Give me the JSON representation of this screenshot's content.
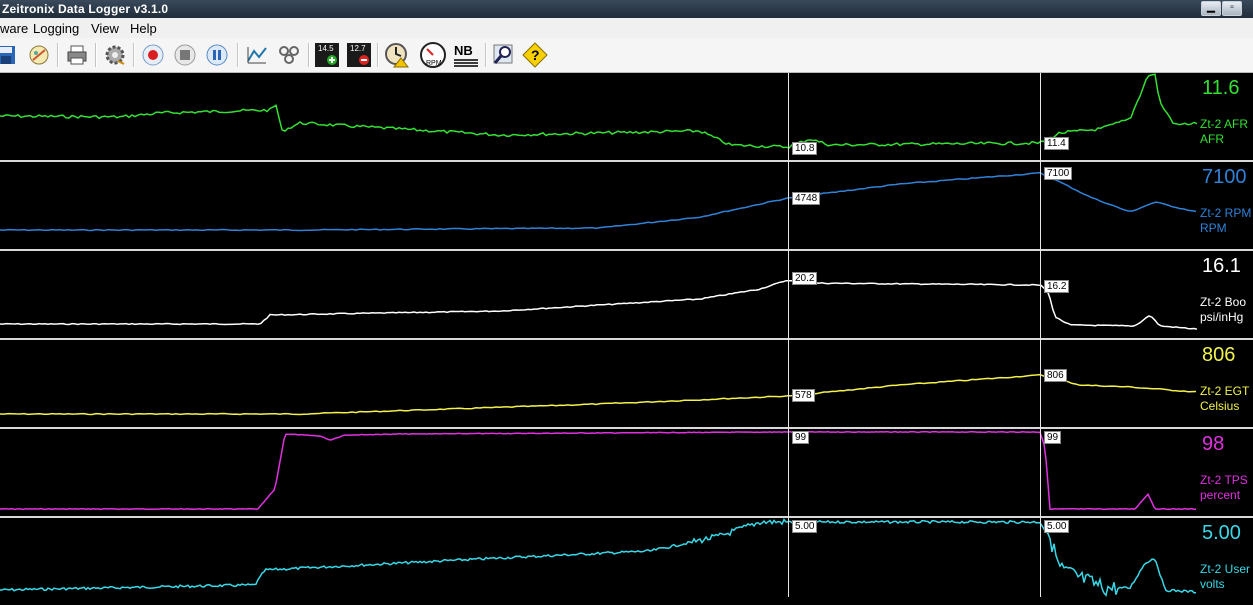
{
  "window": {
    "title": "Zeitronix Data Logger v3.1.0"
  },
  "menu": [
    "ware",
    "Logging",
    "View",
    "Help"
  ],
  "toolbar": {
    "icons": [
      "save-icon",
      "open-log-icon",
      "print-icon",
      "settings-gear-icon",
      "record-icon",
      "stop-icon",
      "pause-icon",
      "graph-icon",
      "pattern-icon",
      "data-add-icon",
      "data-remove-icon",
      "clock-alert-icon",
      "rpm-gauge-icon",
      "nb-icon",
      "zoom-icon",
      "help-icon"
    ],
    "badges": {
      "add": "14.5",
      "remove": "12.7",
      "rpm": "RPM",
      "nb": "NB"
    }
  },
  "cursors": {
    "a": {
      "afr": "10.8",
      "rpm": "4748",
      "boost": "20.2",
      "egt": "578",
      "tps": "99",
      "user": "5.00"
    },
    "b": {
      "afr": "11.4",
      "rpm": "7100",
      "boost": "16.2",
      "egt": "806",
      "tps": "99",
      "user": "5.00"
    }
  },
  "channels": [
    {
      "key": "afr",
      "value": "11.6",
      "name": "Zt-2 AFR",
      "unit": "AFR",
      "color": "#33e033"
    },
    {
      "key": "rpm",
      "value": "7100",
      "name": "Zt-2 RPM",
      "unit": "RPM",
      "color": "#2f82d8"
    },
    {
      "key": "boost",
      "value": "16.1",
      "name": "Zt-2 Boo",
      "unit": "psi/inHg",
      "color": "#ffffff"
    },
    {
      "key": "egt",
      "value": "806",
      "name": "Zt-2 EGT",
      "unit": "Celsius",
      "color": "#f2f24a"
    },
    {
      "key": "tps",
      "value": "98",
      "name": "Zt-2 TPS",
      "unit": "percent",
      "color": "#e030e0"
    },
    {
      "key": "user",
      "value": "5.00",
      "name": "Zt-2 User",
      "unit": "volts",
      "color": "#38d8e8"
    }
  ]
}
